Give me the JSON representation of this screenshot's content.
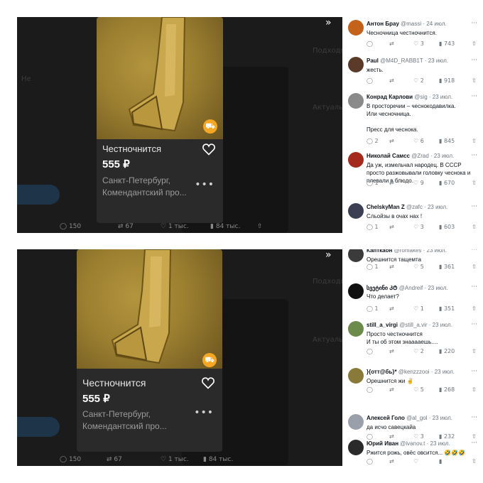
{
  "card": {
    "title": "Честночнится",
    "price": "555 ₽",
    "location": "Санкт-Петербург, Комендантский про...",
    "more": "•••"
  },
  "stats": {
    "replies": "150",
    "reposts": "67",
    "likes": "1 тыс.",
    "views": "84 тыс."
  },
  "stats_bottom": {
    "replies": "150",
    "reposts": "67",
    "likes": "1 тыс.",
    "views": "84 тыс."
  },
  "expand_icon": "»",
  "top_replies": [
    {
      "name": "Антон Брау",
      "handle": "@massi",
      "date": "· 24 июл.",
      "text": "Чесночница честночнится.",
      "reply": "",
      "repost": "",
      "like": "3",
      "views": "743",
      "avatar": "#c4621b"
    },
    {
      "name": "Paul",
      "handle": "@M4D_RABB1T",
      "date": "· 23 июл.",
      "text": "жесть.",
      "reply": "",
      "repost": "",
      "like": "2",
      "views": "918",
      "avatar": "#5a3b2a"
    },
    {
      "name": "Конрад Карлови",
      "handle": "@sig",
      "date": "· 23 июл.",
      "text": "В просторечии – чеснокодавилка.\nИли чесночница.\n\nПресс для чеснока.",
      "reply": "2",
      "repost": "",
      "like": "6",
      "views": "845",
      "avatar": "#8a8a8a"
    },
    {
      "name": "Николай Самсс",
      "handle": "@Zrad",
      "date": "· 23 июл.",
      "text": "Да уж, измельчал народец. В СССР просто разжовывали головку чеснока и плевали в блюдо.",
      "reply": "1",
      "repost": "",
      "like": "9",
      "views": "670",
      "avatar": "#a42a1e"
    },
    {
      "name": "ChelskyMan Z",
      "handle": "@zafc",
      "date": "· 23 июл.",
      "text": "Сльойзы в очах нах !",
      "reply": "1",
      "repost": "",
      "like": "3",
      "views": "603",
      "avatar": "#3a3f52"
    }
  ],
  "bottom_replies": [
    {
      "name": "Капткаон",
      "handle": "@romakes",
      "date": "· 23 июл.",
      "text": "Орешнится тащемта",
      "reply": "1",
      "repost": "",
      "like": "5",
      "views": "361",
      "avatar": "#3b3b3b"
    },
    {
      "name": "სვეტინი ᲙᲢ",
      "handle": "@Andreif",
      "date": "· 23 июл.",
      "text": "Что делает?",
      "reply": "1",
      "repost": "",
      "like": "1",
      "views": "351",
      "avatar": "#111111"
    },
    {
      "name": "still_a_virgi",
      "handle": "@still_a.vir",
      "date": "· 23 июл.",
      "text": "Просто честночнится\nИ ты об этом знааааешь....",
      "reply": "",
      "repost": "",
      "like": "2",
      "views": "220",
      "avatar": "#6c8a4a"
    },
    {
      "name": "}{отт@бь}*",
      "handle": "@kenzzzooi",
      "date": "· 23 июл.",
      "text": "Орешнится жи ✌",
      "reply": "",
      "repost": "",
      "like": "5",
      "views": "268",
      "avatar": "#8a7a3a"
    },
    {
      "name": "Алексей Голо",
      "handle": "@al_gol",
      "date": "· 23 июл.",
      "text": "да исчо савецкайа",
      "reply": "",
      "repost": "",
      "like": "3",
      "views": "232",
      "avatar": "#9aa0aa"
    },
    {
      "name": "Юрий Иван",
      "handle": "@ivanov.t",
      "date": "· 23 июл.",
      "text": "Ржится рожь, овёс овсится... 🤣🤣🤣",
      "reply": "",
      "repost": "",
      "like": "",
      "views": "",
      "avatar": "#2a2a2a"
    }
  ],
  "ghost": {
    "a1": "Подходящие",
    "a2": "Актуальные",
    "a3": "Не"
  }
}
